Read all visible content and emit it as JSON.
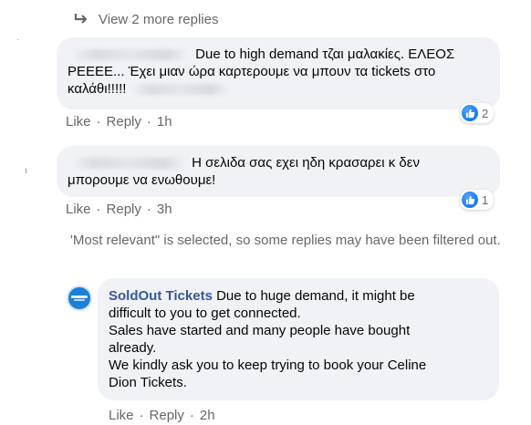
{
  "view_more": {
    "label": "View 2 more replies"
  },
  "comments": [
    {
      "text_line1": "Due to high demand τζαι μαλακίες. ΕΛΕΟΣ",
      "text_line2": "ΡΕΕΕΕ... Έχει μιαν ώρα καρτερουμε να μπουν τα tickets στο",
      "text_line3": "καλάθι!!!!!",
      "actions": {
        "like": "Like",
        "reply": "Reply",
        "time": "1h"
      },
      "reaction_count": "2"
    },
    {
      "text_line1": "Η σελιδα σας εχει ηδη κρασαρει κ δεν",
      "text_line2": "μπορουμε να ενωθουμε!",
      "actions": {
        "like": "Like",
        "reply": "Reply",
        "time": "3h"
      },
      "reaction_count": "1"
    }
  ],
  "filter_notice": "'Most relevant\" is selected, so some replies may have been filtered out.",
  "reply": {
    "author": "SoldOut Tickets",
    "line1": "Due to huge demand, it might be",
    "line2": "difficult to you to get connected.",
    "line3": "Sales have started and many people have bought",
    "line4": "already.",
    "line5": "We kindly ask you to keep trying to book your Celine",
    "line6": "Dion Tickets.",
    "actions": {
      "like": "Like",
      "reply": "Reply",
      "time": "2h"
    }
  },
  "colors": {
    "reaction_blue": "#1877f2",
    "bubble_bg": "#f0f2f5",
    "meta_gray": "#65676b"
  }
}
